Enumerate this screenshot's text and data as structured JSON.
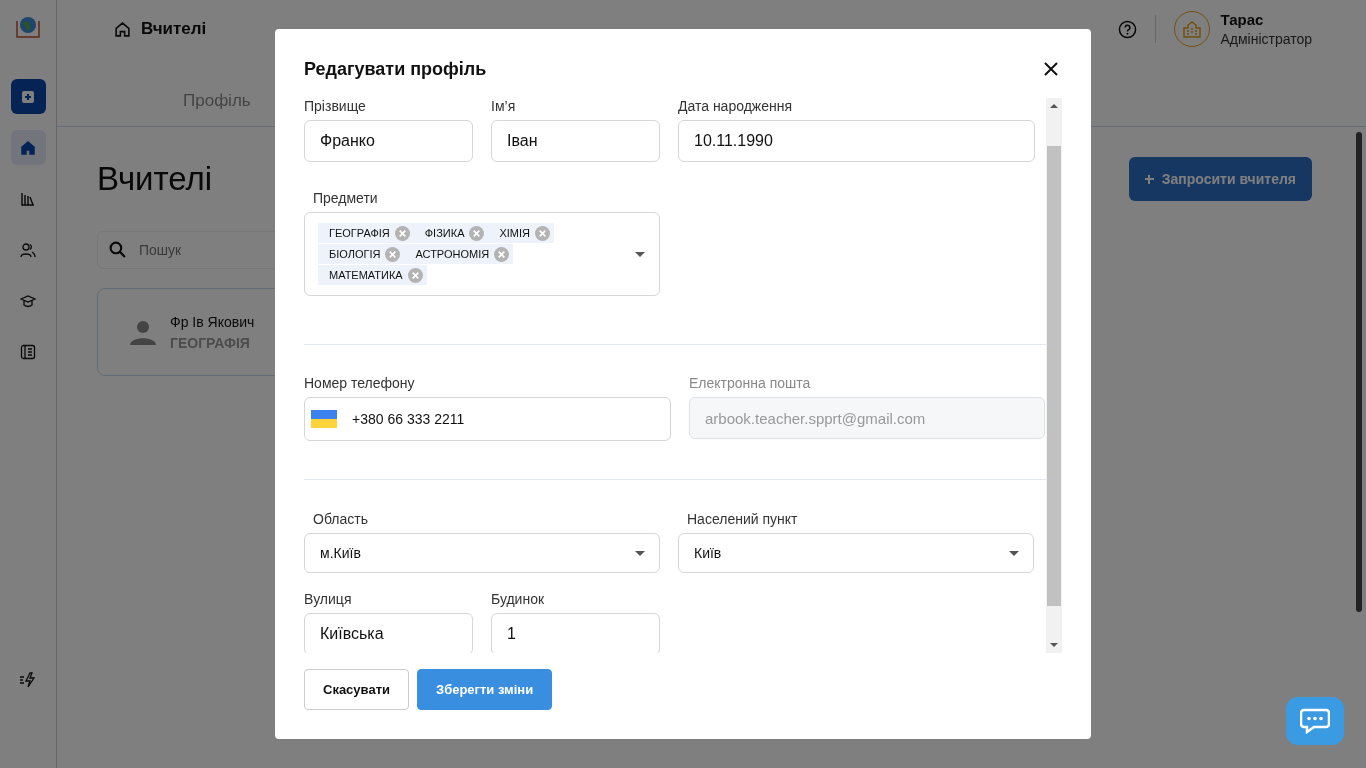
{
  "sidebar": {
    "items": [
      {
        "kind": "add",
        "selected": false
      },
      {
        "kind": "home",
        "selected": true
      },
      {
        "kind": "books",
        "selected": false
      },
      {
        "kind": "people",
        "selected": false
      },
      {
        "kind": "graduation",
        "selected": false
      },
      {
        "kind": "notebook",
        "selected": false
      }
    ],
    "bottom_item": {
      "kind": "bolt"
    }
  },
  "header": {
    "breadcrumb": "Вчителі",
    "user": {
      "name": "Тарас",
      "role": "Адміністратор"
    }
  },
  "tabs": [
    {
      "label": "Профіль",
      "selected": false
    }
  ],
  "page": {
    "title": "Вчителі",
    "search": {
      "placeholder": "Пошук"
    },
    "invite_button": "Запросити вчителя",
    "teachers": [
      {
        "name": "Фр Ів Якович",
        "subject": "ГЕОГРАФІЯ"
      }
    ]
  },
  "modal": {
    "title": "Редагувати профіль",
    "sections": [
      {
        "rows": [
          [
            {
              "kind": "text",
              "label": "Прізвище",
              "value": "Франко"
            },
            {
              "kind": "text",
              "label": "Ім’я",
              "value": "Іван"
            },
            {
              "kind": "date",
              "label": "Дата народження",
              "value": "10.11.1990"
            }
          ],
          [
            {
              "kind": "tags",
              "label": "Предмети",
              "tags": [
                "ГЕОГРАФІЯ",
                "ФІЗИКА",
                "ХІМІЯ",
                "БІОЛОГІЯ",
                "АСТРОНОМІЯ",
                "МАТЕМАТИКА"
              ]
            }
          ]
        ]
      },
      {
        "rows": [
          [
            {
              "kind": "phone",
              "label": "Номер телефону",
              "value": "+380 66 333 2211"
            },
            {
              "kind": "email",
              "label": "Електронна пошта",
              "value": "arbook.teacher.spprt@gmail.com",
              "disabled": true
            }
          ]
        ]
      },
      {
        "rows": [
          [
            {
              "kind": "select",
              "label": "Область",
              "value": "м.Київ"
            },
            {
              "kind": "select",
              "label": "Населений пункт",
              "value": "Київ"
            }
          ],
          [
            {
              "kind": "text",
              "label": "Вулиця",
              "value": "Київська"
            },
            {
              "kind": "text",
              "label": "Будинок",
              "value": "1"
            }
          ]
        ]
      }
    ],
    "buttons": [
      {
        "kind": "secondary",
        "label": "Скасувати"
      },
      {
        "kind": "primary",
        "label": "Зберегти зміни"
      }
    ]
  }
}
